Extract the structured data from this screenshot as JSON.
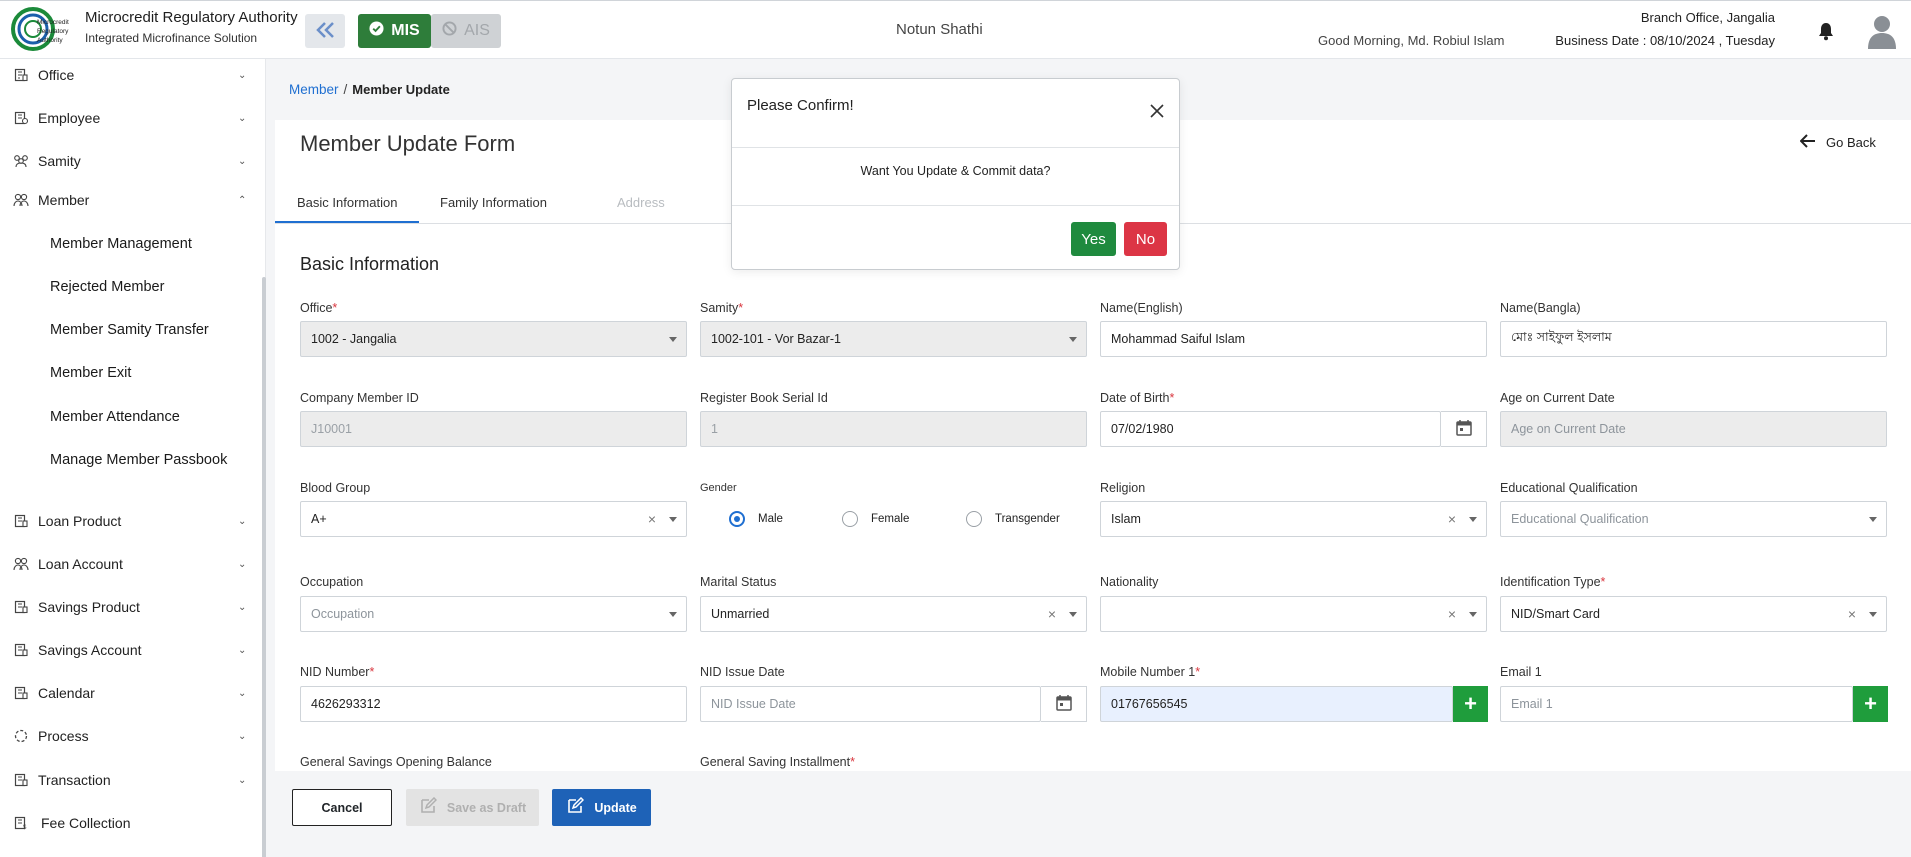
{
  "header": {
    "logo_text": "Microcredit Regulatory Authority",
    "org_title": "Microcredit Regulatory Authority",
    "org_subtitle": "Integrated Microfinance Solution",
    "mis_label": "MIS",
    "ais_label": "AIS",
    "app_name": "Notun Shathi",
    "greeting": "Good Morning, Md. Robiul Islam",
    "branch": "Branch Office, Jangalia",
    "business_date": "Business Date : 08/10/2024 , Tuesday",
    "colors": {
      "mis": "#2e7d3a",
      "accent": "#1f6fd1"
    }
  },
  "sidebar": {
    "items": [
      {
        "label": "Office",
        "icon": "office-icon",
        "expanded": false
      },
      {
        "label": "Employee",
        "icon": "employee-icon",
        "expanded": false
      },
      {
        "label": "Samity",
        "icon": "samity-icon",
        "expanded": false
      },
      {
        "label": "Member",
        "icon": "member-icon",
        "expanded": true
      },
      {
        "label": "Loan Product",
        "icon": "loan-product-icon",
        "expanded": false
      },
      {
        "label": "Loan Account",
        "icon": "loan-account-icon",
        "expanded": false
      },
      {
        "label": "Savings Product",
        "icon": "savings-product-icon",
        "expanded": false
      },
      {
        "label": "Savings Account",
        "icon": "savings-account-icon",
        "expanded": false
      },
      {
        "label": "Calendar",
        "icon": "calendar-icon",
        "expanded": false
      },
      {
        "label": "Process",
        "icon": "process-icon",
        "expanded": false
      },
      {
        "label": "Transaction",
        "icon": "transaction-icon",
        "expanded": false
      },
      {
        "label": "Fee Collection",
        "icon": "fee-collection-icon",
        "expanded": false
      }
    ],
    "member_subitems": [
      "Member Management",
      "Rejected Member",
      "Member Samity Transfer",
      "Member Exit",
      "Member Attendance",
      "Manage Member Passbook"
    ]
  },
  "breadcrumb": {
    "parent": "Member",
    "current": "Member Update"
  },
  "form": {
    "title": "Member Update Form",
    "go_back": "Go Back",
    "tabs": [
      "Basic Information",
      "Family Information",
      "Address"
    ],
    "section": "Basic Information",
    "fields": {
      "office": {
        "label": "Office",
        "value": "1002 - Jangalia"
      },
      "samity": {
        "label": "Samity",
        "value": "1002-101 - Vor Bazar-1"
      },
      "name_en": {
        "label": "Name(English)",
        "value": "Mohammad Saiful Islam"
      },
      "name_bn": {
        "label": "Name(Bangla)",
        "value": "মোঃ সাইফুল ইসলাম"
      },
      "company_member_id": {
        "label": "Company Member ID",
        "value": "J10001"
      },
      "register_serial": {
        "label": "Register Book Serial Id",
        "value": "1"
      },
      "dob": {
        "label": "Date of Birth",
        "value": "07/02/1980"
      },
      "age": {
        "label": "Age on Current Date",
        "placeholder": "Age on Current Date"
      },
      "blood_group": {
        "label": "Blood Group",
        "value": "A+"
      },
      "gender": {
        "label": "Gender",
        "options": [
          "Male",
          "Female",
          "Transgender"
        ],
        "selected": "Male"
      },
      "religion": {
        "label": "Religion",
        "value": "Islam"
      },
      "education": {
        "label": "Educational Qualification",
        "placeholder": "Educational Qualification"
      },
      "occupation": {
        "label": "Occupation",
        "placeholder": "Occupation"
      },
      "marital": {
        "label": "Marital Status",
        "value": "Unmarried"
      },
      "nationality": {
        "label": "Nationality",
        "value": ""
      },
      "id_type": {
        "label": "Identification Type",
        "value": "NID/Smart Card"
      },
      "nid": {
        "label": "NID Number",
        "value": "4626293312"
      },
      "nid_issue": {
        "label": "NID Issue Date",
        "placeholder": "NID Issue Date"
      },
      "mobile1": {
        "label": "Mobile Number 1",
        "value": "01767656545"
      },
      "email1": {
        "label": "Email 1",
        "placeholder": "Email 1"
      },
      "gen_savings_balance": {
        "label": "General Savings Opening Balance"
      },
      "gen_saving_installment": {
        "label": "General Saving Installment"
      }
    },
    "buttons": {
      "cancel": "Cancel",
      "draft": "Save as Draft",
      "update": "Update"
    }
  },
  "modal": {
    "title": "Please Confirm!",
    "message": "Want You Update & Commit data?",
    "yes": "Yes",
    "no": "No"
  }
}
